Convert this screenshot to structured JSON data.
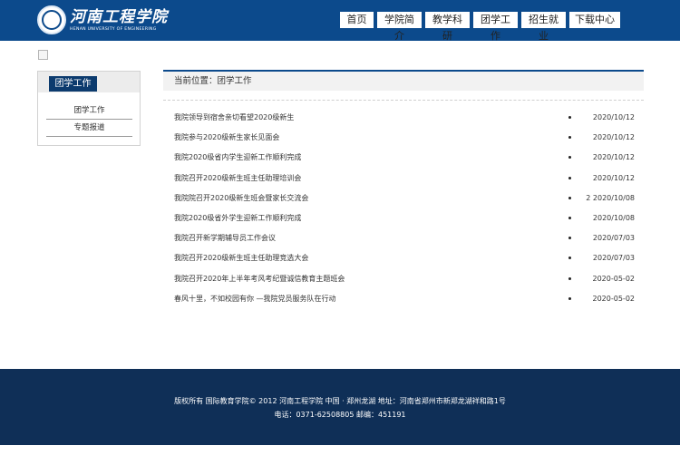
{
  "header": {
    "logo_cn": "河南工程学院",
    "logo_en": "HENAN UNIVERSITY OF ENGINEERING",
    "nav": [
      "首页",
      "学院简介",
      "教学科研",
      "团学工作",
      "招生就业",
      "下载中心"
    ]
  },
  "sidebar": {
    "title": "团学工作",
    "items": [
      "团学工作",
      "专题报道"
    ]
  },
  "breadcrumb": "当前位置：团学工作",
  "news": [
    {
      "title": "我院领导到宿舍亲切看望2020级新生",
      "date": "2020/10/12"
    },
    {
      "title": "我院参与2020级新生家长见面会",
      "date": "2020/10/12"
    },
    {
      "title": "我院2020级省内学生迎新工作顺利完成",
      "date": "2020/10/12"
    },
    {
      "title": "我院召开2020级新生班主任助理培训会",
      "date": "2020/10/12"
    },
    {
      "title": "我院院召开2020级新生班会暨家长交流会",
      "date": "2 2020/10/08"
    },
    {
      "title": "我院2020级省外学生迎新工作顺利完成",
      "date": "2020/10/08"
    },
    {
      "title": "我院召开新学期辅导员工作会议",
      "date": "2020/07/03"
    },
    {
      "title": "我院召开2020级新生班主任助理竞选大会",
      "date": "2020/07/03"
    },
    {
      "title": "我院召开2020年上半年考风考纪暨诚信教育主题班会",
      "date": "2020-05-02"
    },
    {
      "title": "春风十里，不如校园有你 —我院党员服务队在行动",
      "date": "2020-05-02"
    }
  ],
  "footer": {
    "line1": "版权所有 国际教育学院© 2012 河南工程学院 中国 · 郑州龙湖 地址：河南省郑州市新郑龙湖祥和路1号",
    "line2": "电话：0371-62508805 邮编：451191"
  },
  "colors": {
    "header_bg": "#0c4a8c",
    "footer_bg": "#0f2f57",
    "accent": "#0c3b6e"
  }
}
